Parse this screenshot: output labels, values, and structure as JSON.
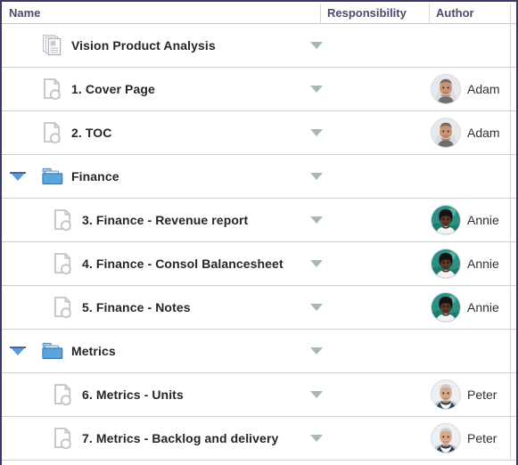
{
  "header": {
    "columns": [
      {
        "label": "Name",
        "key": "name"
      },
      {
        "label": "Responsibility",
        "key": "responsibility"
      },
      {
        "label": "Author",
        "key": "author"
      }
    ]
  },
  "colors": {
    "border_navy": "#3a3a6a",
    "row_divider": "#cfcfcf",
    "header_text": "#4a4a6a",
    "row_text": "#262626",
    "folder_blue": "#5b9bd5",
    "twisty_blue": "#5b9bd5",
    "caret_gray": "#a8b6bb",
    "doc_gray": "#c4c9cc"
  },
  "rows": [
    {
      "id": "vision-product-analysis",
      "label": "Vision Product Analysis",
      "icon": "document-stack-icon",
      "indent": 0,
      "twisty": "none",
      "responsibility_dropdown": true,
      "author": null,
      "avatar": null
    },
    {
      "id": "cover-page",
      "label": "1. Cover Page",
      "icon": "document-icon",
      "indent": 0,
      "twisty": "none",
      "responsibility_dropdown": true,
      "author": "Adam",
      "avatar": "adam-avatar"
    },
    {
      "id": "toc",
      "label": "2. TOC",
      "icon": "document-icon",
      "indent": 0,
      "twisty": "none",
      "responsibility_dropdown": true,
      "author": "Adam",
      "avatar": "adam-avatar"
    },
    {
      "id": "finance-folder",
      "label": "Finance",
      "icon": "folder-icon",
      "indent": 0,
      "twisty": "expanded",
      "responsibility_dropdown": true,
      "author": null,
      "avatar": null
    },
    {
      "id": "finance-revenue-report",
      "label": "3. Finance - Revenue report",
      "icon": "document-icon",
      "indent": 1,
      "twisty": "none",
      "responsibility_dropdown": true,
      "author": "Annie",
      "avatar": "annie-avatar"
    },
    {
      "id": "finance-consol-balancesheet",
      "label": "4. Finance - Consol Balancesheet",
      "icon": "document-icon",
      "indent": 1,
      "twisty": "none",
      "responsibility_dropdown": true,
      "author": "Annie",
      "avatar": "annie-avatar"
    },
    {
      "id": "finance-notes",
      "label": "5. Finance - Notes",
      "icon": "document-icon",
      "indent": 1,
      "twisty": "none",
      "responsibility_dropdown": true,
      "author": "Annie",
      "avatar": "annie-avatar"
    },
    {
      "id": "metrics-folder",
      "label": "Metrics",
      "icon": "folder-icon",
      "indent": 0,
      "twisty": "expanded",
      "responsibility_dropdown": true,
      "author": null,
      "avatar": null
    },
    {
      "id": "metrics-units",
      "label": "6. Metrics - Units",
      "icon": "document-icon",
      "indent": 1,
      "twisty": "none",
      "responsibility_dropdown": true,
      "author": "Peter",
      "avatar": "peter-avatar"
    },
    {
      "id": "metrics-backlog-and-delivery",
      "label": "7. Metrics - Backlog and delivery",
      "icon": "document-icon",
      "indent": 1,
      "twisty": "none",
      "responsibility_dropdown": true,
      "author": "Peter",
      "avatar": "peter-avatar"
    }
  ]
}
